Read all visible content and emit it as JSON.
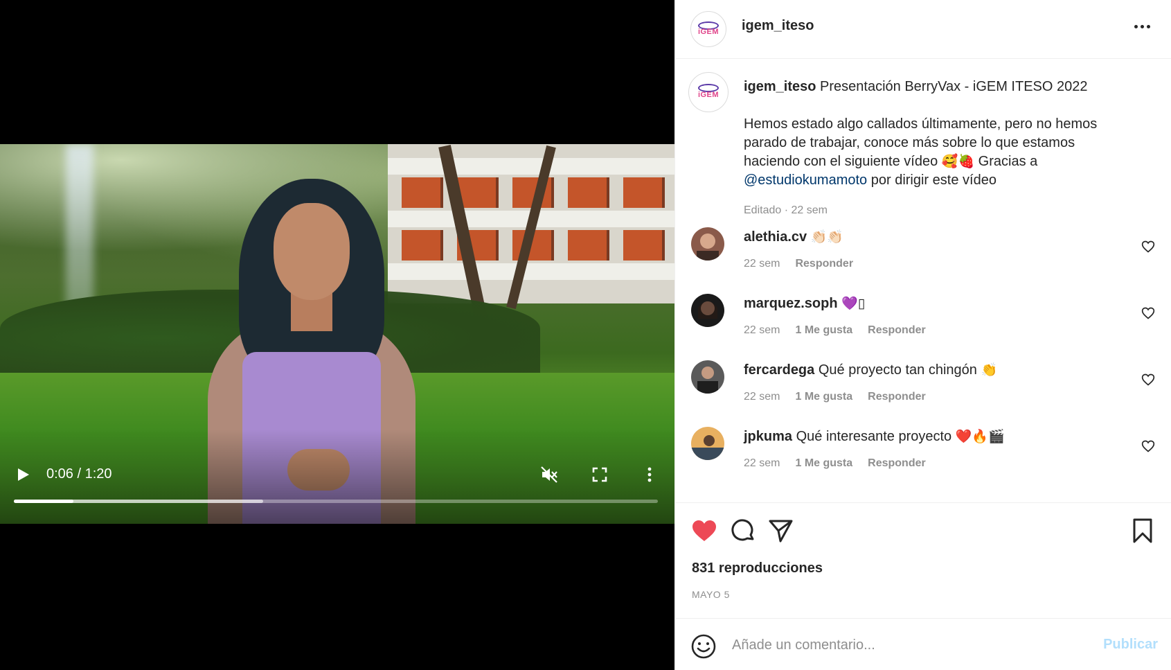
{
  "video": {
    "time_display": "0:06 / 1:20",
    "progress": 0.093,
    "buffered": 0.387
  },
  "header": {
    "username": "igem_iteso",
    "logo_text": "iGEM"
  },
  "caption": {
    "username": "igem_iteso",
    "title": "Presentación BerryVax - iGEM ITESO 2022",
    "text_1": "Hemos estado algo callados últimamente, pero no hemos parado de trabajar, conoce más sobre lo que estamos haciendo con el siguiente vídeo",
    "emoji_1": "🥰🍓",
    "text_2": "Gracias a",
    "mention": "@estudiokumamoto",
    "text_3": "por dirigir este vídeo",
    "meta": "Editado · 22 sem"
  },
  "comments": [
    {
      "username": "alethia.cv",
      "text": "",
      "emoji": "👏🏻👏🏻",
      "time": "22 sem",
      "likes": "",
      "reply": "Responder"
    },
    {
      "username": "marquez.soph",
      "text": "",
      "emoji": "💜▯",
      "time": "22 sem",
      "likes": "1 Me gusta",
      "reply": "Responder"
    },
    {
      "username": "fercardega",
      "text": "Qué proyecto tan chingón",
      "emoji": "👏",
      "time": "22 sem",
      "likes": "1 Me gusta",
      "reply": "Responder"
    },
    {
      "username": "jpkuma",
      "text": "Qué interesante proyecto",
      "emoji": "❤️🔥🎬",
      "time": "22 sem",
      "likes": "1 Me gusta",
      "reply": "Responder"
    }
  ],
  "stats": {
    "views": "831 reproducciones",
    "date": "MAYO 5"
  },
  "comment_box": {
    "placeholder": "Añade un comentario...",
    "publish": "Publicar"
  },
  "colors": {
    "like_red": "#ed4956",
    "mention_blue": "#00376b",
    "publish_disabled": "#b2dffc"
  }
}
